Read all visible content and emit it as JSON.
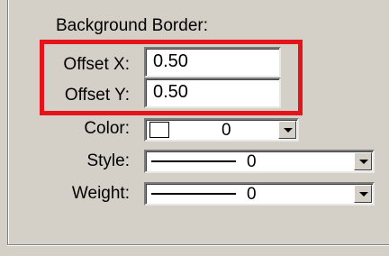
{
  "dialog": {
    "section_title": "Background Border:",
    "offset_x": {
      "label": "Offset X:",
      "value": "0.50"
    },
    "offset_y": {
      "label": "Offset Y:",
      "value": "0.50"
    },
    "color": {
      "label": "Color:",
      "value": "0",
      "swatch_color": "#ffffff"
    },
    "style": {
      "label": "Style:",
      "value": "0"
    },
    "weight": {
      "label": "Weight:",
      "value": "0"
    }
  },
  "colors": {
    "panel_bg": "#d4d0c8",
    "highlight_red": "#e4141a"
  }
}
